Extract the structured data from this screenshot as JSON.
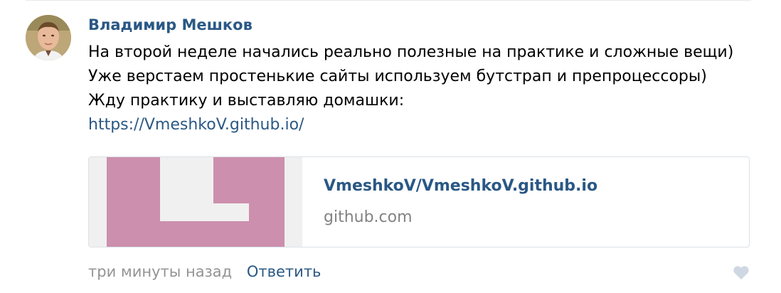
{
  "comment": {
    "author": "Владимир Мешков",
    "text": "На второй неделе начались реально полезные на практике и сложные вещи) Уже верстаем простенькие сайты используем бутстрап и препроцессоры) Жду практику и выставляю домашки:",
    "link": "https://VmeshkoV.github.io/"
  },
  "attachment": {
    "title": "VmeshkoV/VmeshkoV.github.io",
    "domain": "github.com",
    "thumb_color": "#cc8fad",
    "icon": "identicon-thumbnail"
  },
  "footer": {
    "time": "три минуты назад",
    "reply_label": "Ответить",
    "like_icon": "heart-icon"
  },
  "colors": {
    "link": "#2a5885",
    "muted": "#939393",
    "like": "#cfd8e2"
  }
}
